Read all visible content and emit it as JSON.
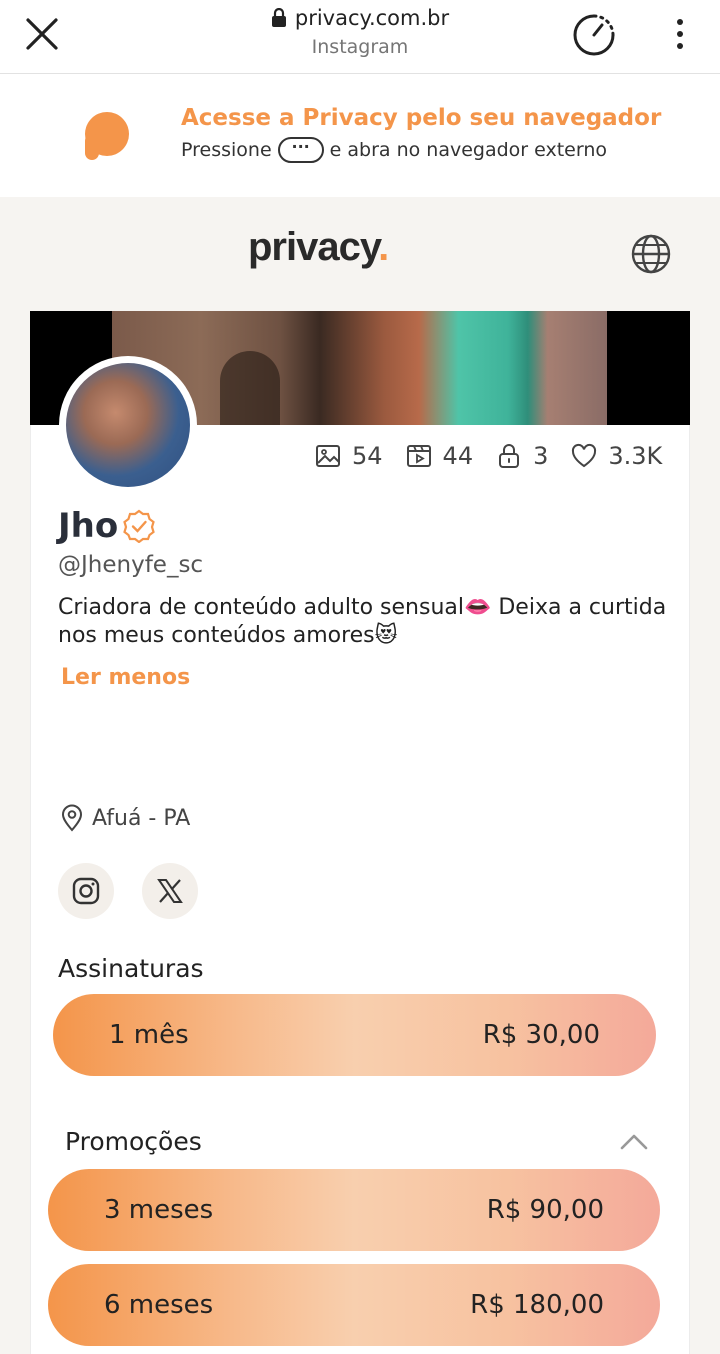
{
  "browser": {
    "url": "privacy.com.br",
    "source": "Instagram"
  },
  "banner": {
    "title": "Acesse a Privacy pelo seu navegador",
    "press": "Pressione",
    "pill": "···",
    "rest": "e abra no navegador externo"
  },
  "header": {
    "brand": "privacy",
    "brand_dot": "."
  },
  "profile": {
    "stats": {
      "photos": "54",
      "videos": "44",
      "locked": "3",
      "likes": "3.3K"
    },
    "name": "Jho",
    "handle": "@Jhenyfe_sc",
    "bio": "Criadora de conteúdo adulto sensual👄 Deixa a curtida nos meus conteúdos amores😻",
    "read_less": "Ler menos",
    "location": "Afuá - PA"
  },
  "subscriptions": {
    "title": "Assinaturas",
    "plans": [
      {
        "label": "1 mês",
        "price": "R$ 30,00"
      }
    ]
  },
  "promotions": {
    "title": "Promoções",
    "plans": [
      {
        "label": "3 meses",
        "price": "R$ 90,00"
      },
      {
        "label": "6 meses",
        "price": "R$ 180,00"
      }
    ]
  },
  "colors": {
    "accent": "#f4954a",
    "header_bg": "#f6f4f1"
  }
}
